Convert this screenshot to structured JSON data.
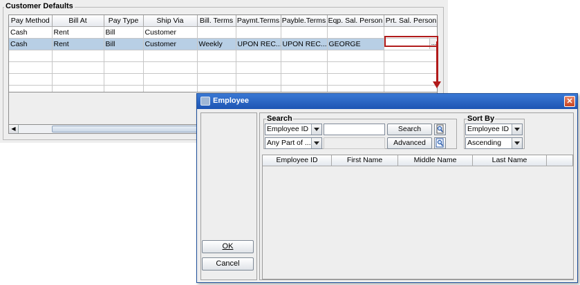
{
  "customer_defaults": {
    "title": "Customer Defaults",
    "columns": [
      "Pay Method",
      "Bill At",
      "Pay Type",
      "Ship Via",
      "Bill. Terms",
      "Paymt.Terms",
      "Payble.Terms",
      "Eqp. Sal. Person",
      "Prt. Sal. Person"
    ],
    "rows": [
      [
        "Cash",
        "Rent",
        "Bill",
        "Customer",
        "",
        "",
        "",
        "",
        ""
      ],
      [
        "Cash",
        "Rent",
        "Bill",
        "Customer",
        "Weekly",
        "UPON REC...",
        "UPON REC...",
        "GEORGE",
        ""
      ]
    ],
    "ellipsis": "...",
    "scroll_left": "◀"
  },
  "dialog": {
    "title": "Employee",
    "close": "✕",
    "search_label": "Search",
    "search_field": "Employee ID",
    "search_match": "Any Part of ...",
    "search_text": "",
    "search_button": "Search",
    "advanced_button": "Advanced",
    "sort_label": "Sort By",
    "sort_field": "Employee ID",
    "sort_order": "Ascending",
    "columns": [
      "Employee ID",
      "First Name",
      "Middle Name",
      "Last Name"
    ],
    "ok_button": "OK",
    "cancel_button": "Cancel"
  },
  "colors": {
    "selection": "#b8cfe5",
    "highlight": "#b11a1a",
    "titlebar": "#2a66c4"
  }
}
